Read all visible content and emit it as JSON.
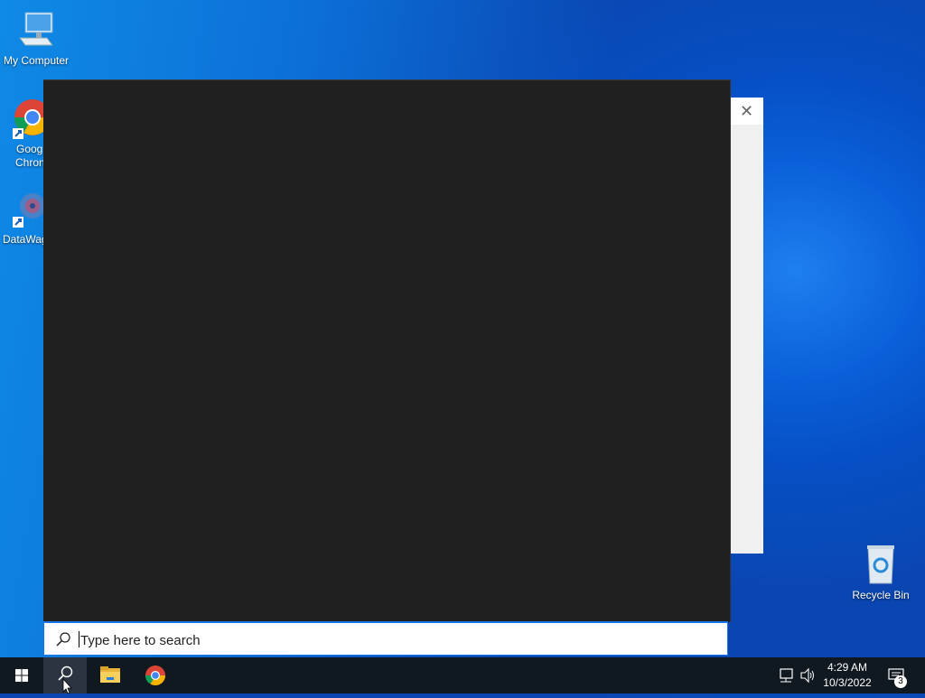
{
  "desktop": {
    "icons": [
      {
        "label": "My Computer"
      },
      {
        "label": "Google Chrome",
        "display_lines": [
          "Goog",
          "Chron"
        ]
      },
      {
        "label": "DataWag"
      },
      {
        "label": "Recycle Bin"
      }
    ]
  },
  "search": {
    "placeholder": "Type here to search",
    "value": ""
  },
  "taskbar": {
    "time": "4:29 AM",
    "date": "10/3/2022",
    "notification_count": "3"
  },
  "colors": {
    "start_panel_bg": "#202020",
    "taskbar_bg": "#101820",
    "accent": "#1a73e8"
  }
}
